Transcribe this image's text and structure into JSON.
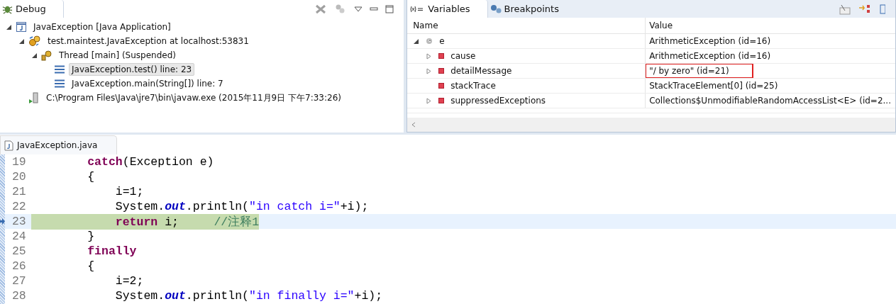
{
  "debug_view": {
    "tab": {
      "label": "Debug",
      "selected": true
    },
    "tree": [
      {
        "label": "JavaException [Java Application]",
        "kind": "app",
        "expanded": true,
        "selected": false,
        "children": [
          {
            "label": "test.maintest.JavaException at localhost:53831",
            "kind": "vm",
            "expanded": true,
            "selected": false,
            "children": [
              {
                "label": "Thread [main] (Suspended)",
                "kind": "thread",
                "expanded": true,
                "selected": false,
                "children": [
                  {
                    "label": "JavaException.test() line: 23",
                    "kind": "frame",
                    "selected": true
                  },
                  {
                    "label": "JavaException.main(String[]) line: 7",
                    "kind": "frame",
                    "selected": false
                  }
                ]
              }
            ]
          },
          {
            "label": "C:\\Program Files\\Java\\jre7\\bin\\javaw.exe (2015年11月9日 下午7:33:26)",
            "kind": "process",
            "selected": false
          }
        ]
      }
    ]
  },
  "variables_view": {
    "tabs": [
      {
        "label": "Variables",
        "selected": true
      },
      {
        "label": "Breakpoints",
        "selected": false
      }
    ],
    "columns": [
      "Name",
      "Value"
    ],
    "rows": [
      {
        "name": "e",
        "value": "ArithmeticException  (id=16)",
        "kind": "local",
        "expanded": true,
        "boxed": false,
        "children": [
          {
            "name": "cause",
            "value": "ArithmeticException  (id=16)",
            "kind": "field",
            "expanded": false,
            "boxed": false
          },
          {
            "name": "detailMessage",
            "value": "\"/ by zero\" (id=21)",
            "kind": "field",
            "expanded": false,
            "boxed": true
          },
          {
            "name": "stackTrace",
            "value": "StackTraceElement[0]  (id=25)",
            "kind": "field",
            "boxed": false
          },
          {
            "name": "suppressedExceptions",
            "value": "Collections$UnmodifiableRandomAccessList<E>  (id=2...",
            "kind": "field",
            "expanded": false,
            "boxed": false
          }
        ]
      }
    ]
  },
  "editor": {
    "tab": {
      "label": "JavaException.java",
      "selected": true
    },
    "lines": [
      {
        "number": "19",
        "current": false,
        "tokens": [
          {
            "kind": "keyword",
            "text": "        catch"
          },
          {
            "kind": "plain",
            "text": "(Exception e)"
          }
        ]
      },
      {
        "number": "20",
        "current": false,
        "tokens": [
          {
            "kind": "plain",
            "text": "        {"
          }
        ]
      },
      {
        "number": "21",
        "current": false,
        "tokens": [
          {
            "kind": "plain",
            "text": "            i=1;"
          }
        ]
      },
      {
        "number": "22",
        "current": false,
        "tokens": [
          {
            "kind": "plain",
            "text": "            System."
          },
          {
            "kind": "field",
            "text": "out"
          },
          {
            "kind": "plain",
            "text": ".println("
          },
          {
            "kind": "string",
            "text": "\"in catch i=\""
          },
          {
            "kind": "plain",
            "text": "+i);"
          }
        ]
      },
      {
        "number": "23",
        "current": true,
        "tokens": [
          {
            "kind": "keyword",
            "text": "            return"
          },
          {
            "kind": "plain",
            "text": " i;     "
          },
          {
            "kind": "comment",
            "text": "//注释1"
          }
        ]
      },
      {
        "number": "24",
        "current": false,
        "tokens": [
          {
            "kind": "plain",
            "text": "        }"
          }
        ]
      },
      {
        "number": "25",
        "current": false,
        "tokens": [
          {
            "kind": "keyword",
            "text": "        finally"
          }
        ]
      },
      {
        "number": "26",
        "current": false,
        "tokens": [
          {
            "kind": "plain",
            "text": "        {"
          }
        ]
      },
      {
        "number": "27",
        "current": false,
        "tokens": [
          {
            "kind": "plain",
            "text": "            i=2;"
          }
        ]
      },
      {
        "number": "28",
        "current": false,
        "tokens": [
          {
            "kind": "plain",
            "text": "            System."
          },
          {
            "kind": "field",
            "text": "out"
          },
          {
            "kind": "plain",
            "text": ".println("
          },
          {
            "kind": "string",
            "text": "\"in finally i=\""
          },
          {
            "kind": "plain",
            "text": "+i);"
          }
        ]
      }
    ]
  }
}
